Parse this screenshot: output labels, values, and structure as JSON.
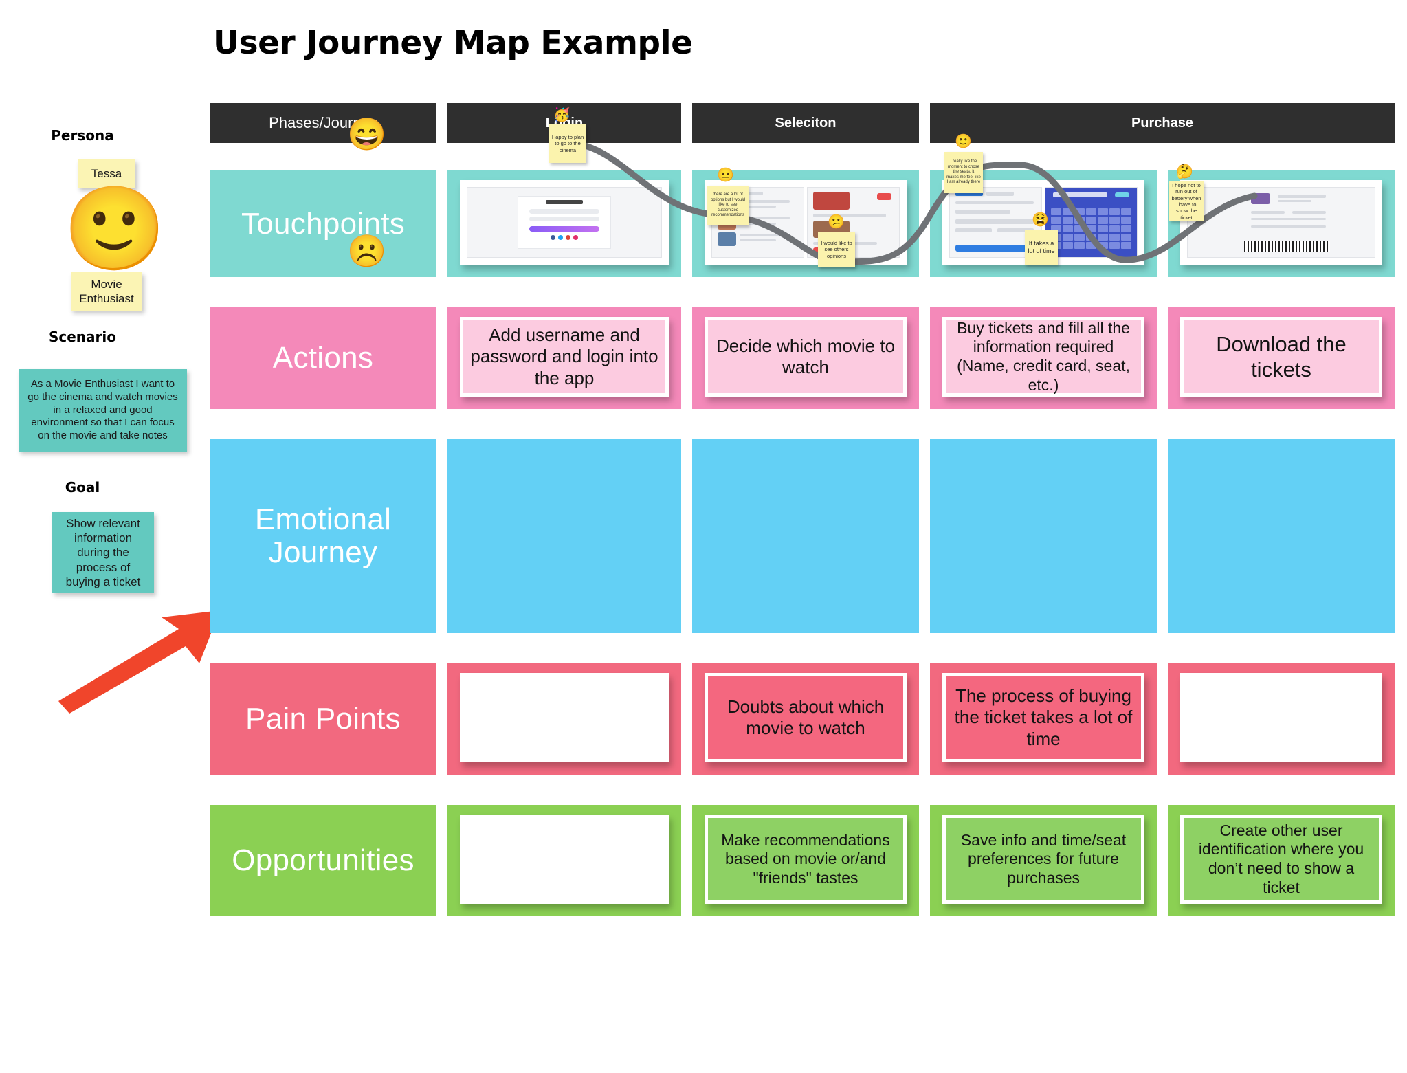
{
  "title": "User Journey Map Example",
  "persona": {
    "heading": "Persona",
    "name": "Tessa",
    "role": "Movie\nEnthusiast",
    "avatar_icon": "woman-with-glasses-emoji"
  },
  "scenario": {
    "heading": "Scenario",
    "text": "As a Movie Enthusiast I want to go the cinema and watch movies in a relaxed and good environment so that I can focus on the movie and take notes"
  },
  "goal": {
    "heading": "Goal",
    "text": "Show relevant information during the process of buying a ticket"
  },
  "annotation": {
    "arrow_icon": "red-arrow-pointing-right",
    "color": "#f0452b"
  },
  "header": {
    "phases_label": "Phases/Journey",
    "columns": [
      "Login",
      "Seleciton",
      "Purchase"
    ]
  },
  "rows": {
    "touchpoints": {
      "label": "Touchpoints",
      "color": "#7fd9d1",
      "cells": [
        "login-screen-mockup",
        "movie-selection-screens-mockup",
        "payment-and-calendar-screens-mockup",
        "ticket-confirmation-mockup"
      ]
    },
    "actions": {
      "label": "Actions",
      "color": "#f489b9",
      "cells": [
        "Add username and password and login into the app",
        "Decide which movie to watch",
        "Buy tickets and fill all the information required (Name, credit card, seat, etc.)",
        "Download the tickets"
      ]
    },
    "emotional": {
      "label": "Emotional\nJourney",
      "color": "#63d0f5",
      "scale_high_icon": "grinning-face-emoji",
      "scale_low_icon": "frowning-face-emoji",
      "notes": [
        {
          "text": "Happy to plan to go to the cinema",
          "emoji": "partying-face-emoji"
        },
        {
          "text": "there are a lot of options but I would like to see customized recommendations",
          "emoji": "neutral-face-emoji"
        },
        {
          "text": "I would like to see others opinions",
          "emoji": "confused-face-emoji"
        },
        {
          "text": "I really like the moment to chose the seats, it makes me feel like I am already there",
          "emoji": "slightly-smiling-face-emoji"
        },
        {
          "text": "It takes a lot of time",
          "emoji": "weary-face-emoji"
        },
        {
          "text": "I hope not to run out of battery when I have to show the ticket",
          "emoji": "thinking-face-emoji"
        }
      ]
    },
    "pain_points": {
      "label": "Pain Points",
      "color": "#f2697f",
      "cells": [
        "",
        "Doubts about which movie to watch",
        "The process of buying the ticket takes a lot of time",
        ""
      ]
    },
    "opportunities": {
      "label": "Opportunities",
      "color": "#8bd053",
      "cells": [
        "",
        "Make recommendations based on movie or/and \"friends\" tastes",
        "Save info and time/seat preferences for future purchases",
        "Create other user identification where you don’t need to show a ticket"
      ]
    }
  }
}
